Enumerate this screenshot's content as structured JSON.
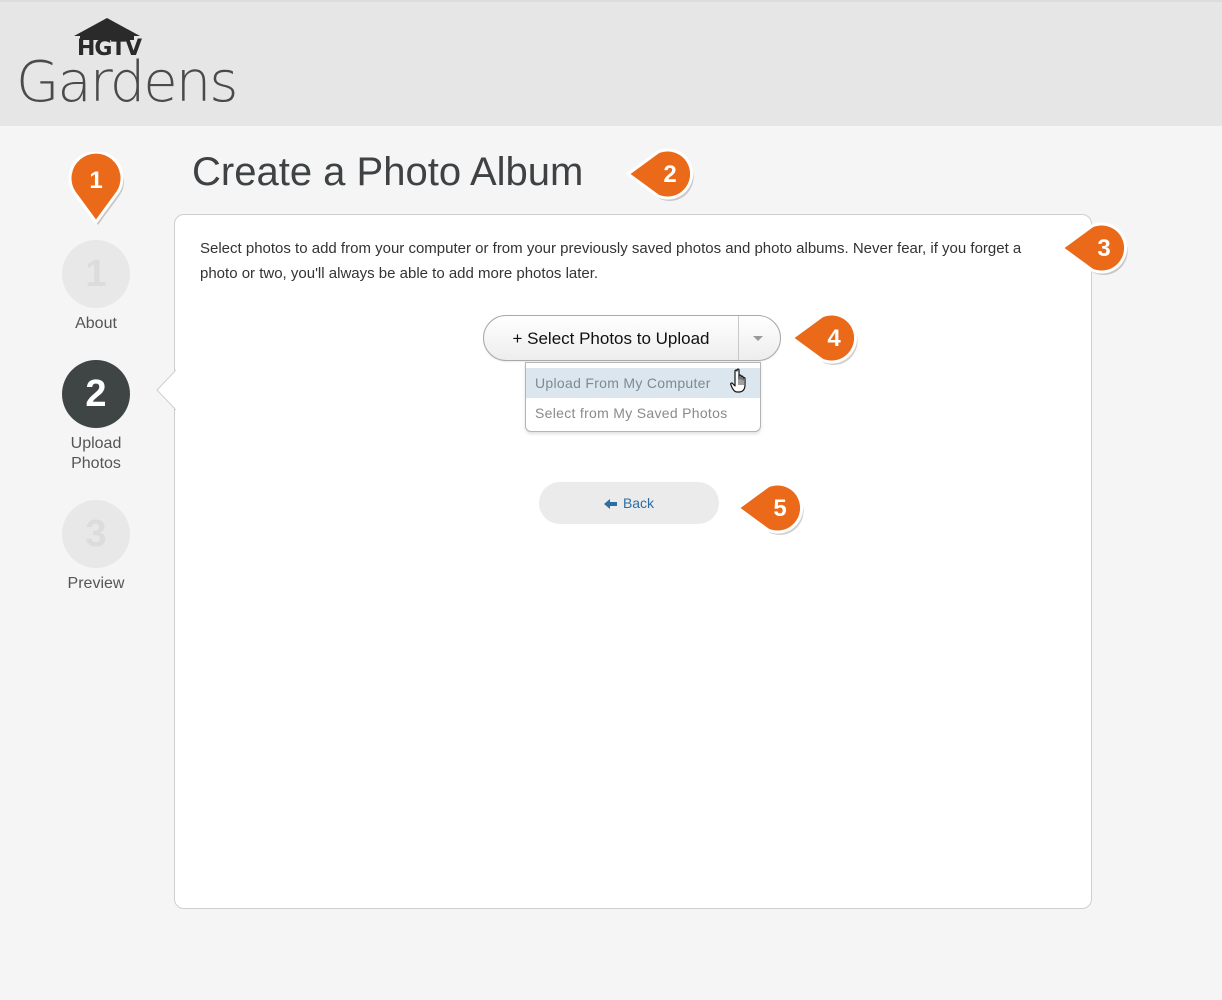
{
  "brand": {
    "top": "HGTV",
    "bottom": "Gardens"
  },
  "steps": [
    {
      "number": "1",
      "label": "About",
      "state": "done"
    },
    {
      "number": "2",
      "label": "Upload Photos",
      "state": "active"
    },
    {
      "number": "3",
      "label": "Preview",
      "state": "upcoming"
    }
  ],
  "title": "Create a Photo Album",
  "description": "Select photos to add from your computer or from your previously saved photos and photo albums. Never fear, if you forget a photo or two, you'll always be able to add more photos later.",
  "select": {
    "label": "+ Select Photos to Upload",
    "options": [
      "Upload From My Computer",
      "Select from My Saved Photos"
    ],
    "highlighted_option": "Upload From My Computer"
  },
  "back_label": "Back",
  "markers": [
    "1",
    "2",
    "3",
    "4",
    "5"
  ],
  "colors": {
    "marker": "#ea6a1a",
    "active_step": "#3f4445",
    "link": "#2b6ea3",
    "header_bg": "#e6e6e7"
  }
}
